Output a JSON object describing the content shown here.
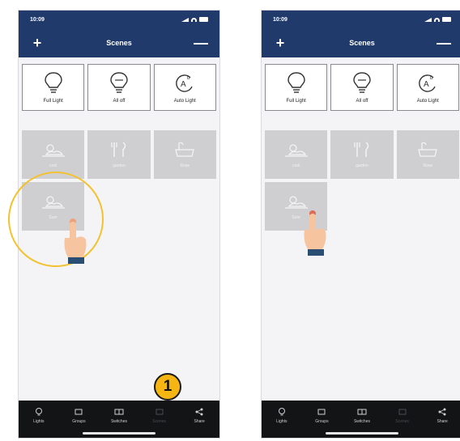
{
  "colors": {
    "header": "#1f3a6b",
    "tab_bar": "#121416",
    "tile": "#cfcfd2",
    "highlight": "#f2c230",
    "badge": "#f5b512"
  },
  "phones": [
    {
      "status_time": "10:09",
      "nav": {
        "add_label": "+",
        "title": "Scenes",
        "remove_label": "—"
      },
      "modes": [
        {
          "label": "Full Light",
          "icon": "bulb-icon"
        },
        {
          "label": "All off",
          "icon": "bulb-off-icon"
        },
        {
          "label": "Auto Light",
          "icon": "auto-light-icon"
        }
      ],
      "scenes": [
        {
          "label": "cool",
          "icon": "sun-cloud-icon"
        },
        {
          "label": "garden",
          "icon": "fork-knife-icon"
        },
        {
          "label": "Rose",
          "icon": "bath-icon"
        },
        {
          "label": "Sunr",
          "icon": "sun-cloud-icon"
        }
      ],
      "tabs": [
        {
          "label": "Lights",
          "icon": "lightbulb-icon"
        },
        {
          "label": "Groups",
          "icon": "groups-icon"
        },
        {
          "label": "Switches",
          "icon": "switches-icon"
        },
        {
          "label": "Scenes",
          "icon": "scenes-icon"
        },
        {
          "label": "Share",
          "icon": "share-icon"
        }
      ]
    },
    {
      "status_time": "10:09",
      "nav": {
        "add_label": "+",
        "title": "Scenes",
        "remove_label": "—"
      },
      "modes": [
        {
          "label": "Full Light",
          "icon": "bulb-icon"
        },
        {
          "label": "All off",
          "icon": "bulb-off-icon"
        },
        {
          "label": "Auto Light",
          "icon": "auto-light-icon"
        }
      ],
      "scenes": [
        {
          "label": "cool",
          "icon": "sun-cloud-icon"
        },
        {
          "label": "garden",
          "icon": "fork-knife-icon"
        },
        {
          "label": "Rose",
          "icon": "bath-icon"
        },
        {
          "label": "Sunr",
          "icon": "sun-cloud-icon"
        }
      ],
      "tabs": [
        {
          "label": "Lights",
          "icon": "lightbulb-icon"
        },
        {
          "label": "Groups",
          "icon": "groups-icon"
        },
        {
          "label": "Switches",
          "icon": "switches-icon"
        },
        {
          "label": "Scenes",
          "icon": "scenes-icon"
        },
        {
          "label": "Share",
          "icon": "share-icon"
        }
      ]
    }
  ],
  "step_badge": "1"
}
